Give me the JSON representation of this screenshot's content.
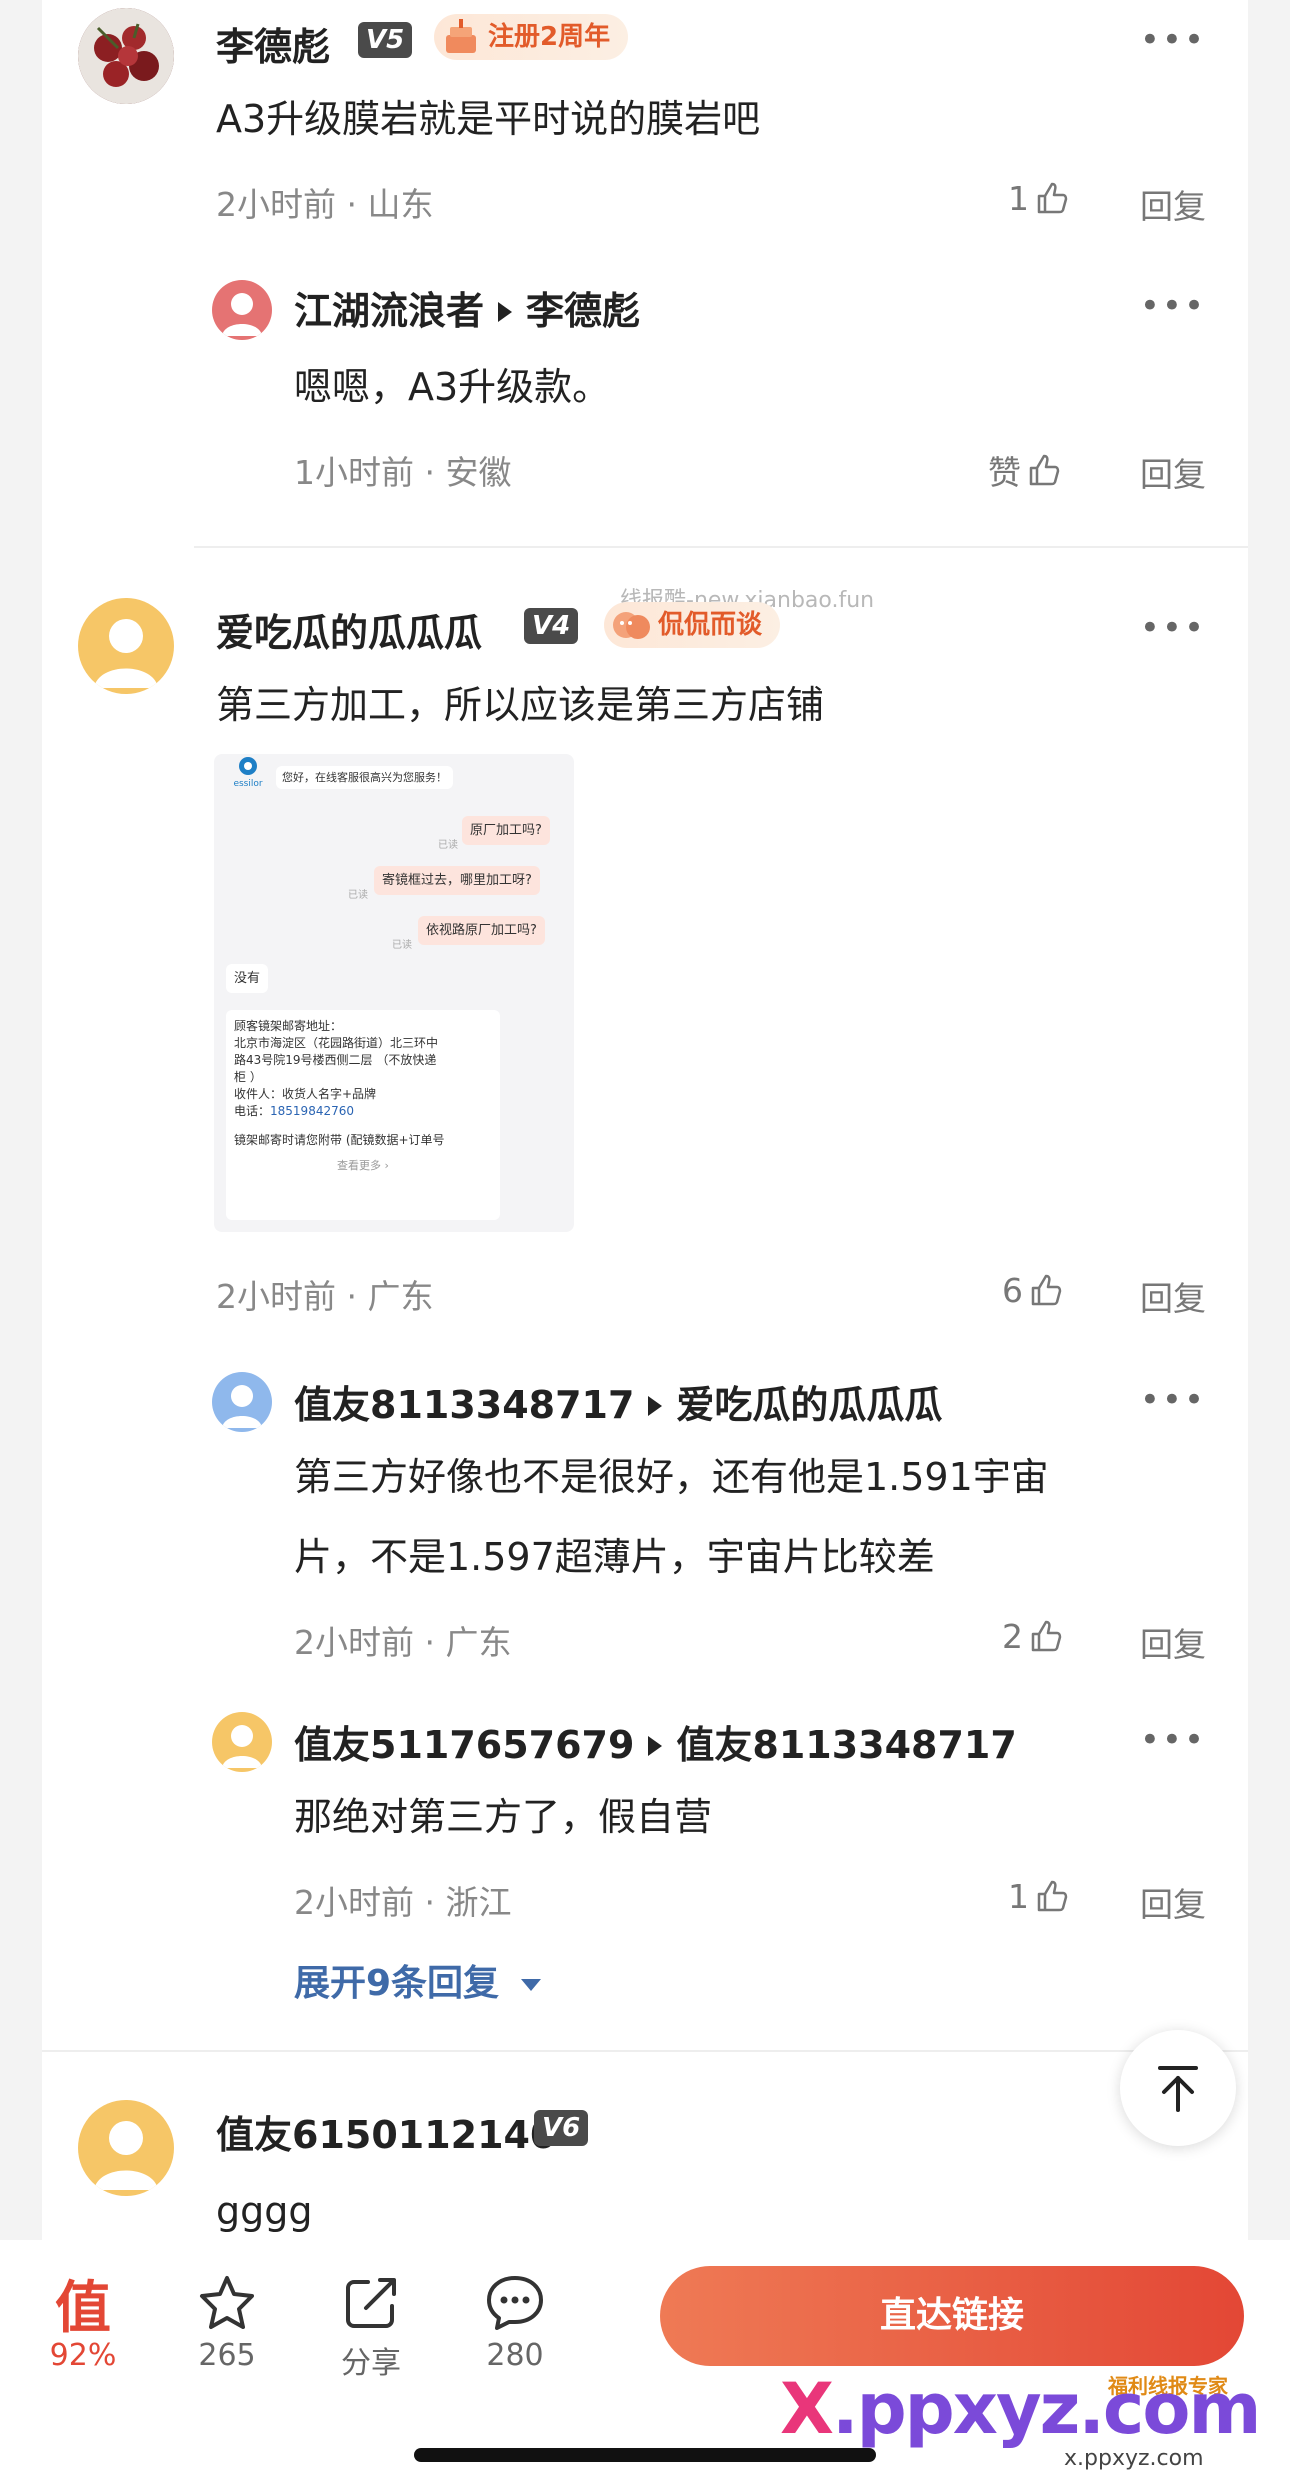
{
  "comments": [
    {
      "user": "李德彪",
      "level": "V5",
      "badge": "注册2周年",
      "text": "A3升级膜岩就是平时说的膜岩吧",
      "meta": "2小时前 · 山东",
      "likes": "1",
      "reply": "回复"
    },
    {
      "user": "爱吃瓜的瓜瓜瓜",
      "level": "V4",
      "badge": "侃侃而谈",
      "text": "第三方加工，所以应该是第三方店铺",
      "meta": "2小时前 · 广东",
      "likes": "6",
      "reply": "回复"
    },
    {
      "user": "值友6150112140",
      "level": "V6",
      "text": "gggg"
    }
  ],
  "replies_1": [
    {
      "user": "江湖流浪者",
      "to": "李德彪",
      "text": "嗯嗯，A3升级款。",
      "meta": "1小时前 · 安徽",
      "likes": "赞",
      "reply": "回复"
    }
  ],
  "replies_2": [
    {
      "user": "值友8113348717",
      "to": "爱吃瓜的瓜瓜瓜",
      "text_line1": "第三方好像也不是很好，还有他是1.591宇宙",
      "text_line2": "片，不是1.597超薄片，宇宙片比较差",
      "meta": "2小时前 · 广东",
      "likes": "2",
      "reply": "回复"
    },
    {
      "user": "值友5117657679",
      "to": "值友8113348717",
      "text": "那绝对第三方了，假自营",
      "meta": "2小时前 · 浙江",
      "likes": "1",
      "reply": "回复"
    }
  ],
  "expand_label": "展开9条回复",
  "watermark_top": "线报酷-new.xianbao.fun",
  "more_label": "•••",
  "chat_image": {
    "brand": "essilor",
    "greeting": "您好，在线客服很高兴为您服务！",
    "read": "已读",
    "msg1": "原厂加工吗?",
    "msg2": "寄镜框过去，哪里加工呀?",
    "msg3": "依视路原厂加工吗?",
    "reply1": "没有",
    "addr_title": "顾客镜架邮寄地址：",
    "addr_l1": "北京市海淀区（花园路街道）北三环中",
    "addr_l2": "路43号院19号楼西侧二层 （不放快递",
    "addr_l3": "柜 ）",
    "addr_l4": "收件人：收货人名字+品牌",
    "addr_phone_label": "电话：",
    "addr_phone": "18519842760",
    "addr_l5": "镜架邮寄时请您附带 (配镜数据+订单号",
    "see_more": "查看更多 ›"
  },
  "bottom_bar": {
    "worth_glyph": "值",
    "worth_pct": "92%",
    "fav_count": "265",
    "share_label": "分享",
    "comment_count": "280",
    "cta": "直达链接"
  },
  "site_watermark": {
    "tag": "福利线报专家",
    "logo_x": "X",
    "logo_rest": ".ppxyz.com",
    "url": "x.ppxyz.com"
  },
  "colors": {
    "accent": "#e34735",
    "link_blue": "#3f6aa8",
    "avatar_yellow": "#f6c667",
    "avatar_blue": "#8fb8ec",
    "avatar_red": "#e57373"
  }
}
